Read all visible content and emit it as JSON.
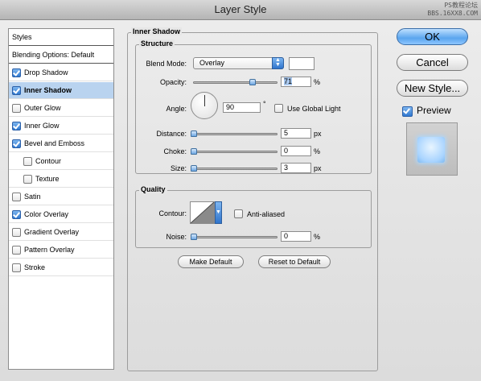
{
  "window": {
    "title": "Layer Style",
    "watermark_line1": "PS教程论坛",
    "watermark_line2": "BBS.16XX8.COM"
  },
  "styles_list": {
    "header": "Styles",
    "items": [
      {
        "label": "Blending Options: Default",
        "checkbox": false,
        "checked": false,
        "selected": false,
        "indent": 0
      },
      {
        "label": "Drop Shadow",
        "checkbox": true,
        "checked": true,
        "selected": false,
        "indent": 0
      },
      {
        "label": "Inner Shadow",
        "checkbox": true,
        "checked": true,
        "selected": true,
        "indent": 0
      },
      {
        "label": "Outer Glow",
        "checkbox": true,
        "checked": false,
        "selected": false,
        "indent": 0
      },
      {
        "label": "Inner Glow",
        "checkbox": true,
        "checked": true,
        "selected": false,
        "indent": 0
      },
      {
        "label": "Bevel and Emboss",
        "checkbox": true,
        "checked": true,
        "selected": false,
        "indent": 0
      },
      {
        "label": "Contour",
        "checkbox": true,
        "checked": false,
        "selected": false,
        "indent": 1
      },
      {
        "label": "Texture",
        "checkbox": true,
        "checked": false,
        "selected": false,
        "indent": 1
      },
      {
        "label": "Satin",
        "checkbox": true,
        "checked": false,
        "selected": false,
        "indent": 0
      },
      {
        "label": "Color Overlay",
        "checkbox": true,
        "checked": true,
        "selected": false,
        "indent": 0
      },
      {
        "label": "Gradient Overlay",
        "checkbox": true,
        "checked": false,
        "selected": false,
        "indent": 0
      },
      {
        "label": "Pattern Overlay",
        "checkbox": true,
        "checked": false,
        "selected": false,
        "indent": 0
      },
      {
        "label": "Stroke",
        "checkbox": true,
        "checked": false,
        "selected": false,
        "indent": 0
      }
    ]
  },
  "panel": {
    "title": "Inner Shadow",
    "structure": {
      "title": "Structure",
      "blend_mode_label": "Blend Mode:",
      "blend_mode_value": "Overlay",
      "shadow_color": "#ffffff",
      "opacity_label": "Opacity:",
      "opacity_value": "71",
      "opacity_unit": "%",
      "opacity_slider": 0.71,
      "angle_label": "Angle:",
      "angle_value": "90",
      "angle_unit": "°",
      "use_global_light_label": "Use Global Light",
      "use_global_light": false,
      "distance_label": "Distance:",
      "distance_value": "5",
      "distance_unit": "px",
      "distance_slider": 0.0,
      "choke_label": "Choke:",
      "choke_value": "0",
      "choke_unit": "%",
      "choke_slider": 0.0,
      "size_label": "Size:",
      "size_value": "3",
      "size_unit": "px",
      "size_slider": 0.0
    },
    "quality": {
      "title": "Quality",
      "contour_label": "Contour:",
      "anti_aliased_label": "Anti-aliased",
      "anti_aliased": false,
      "noise_label": "Noise:",
      "noise_value": "0",
      "noise_unit": "%",
      "noise_slider": 0.0
    },
    "make_default_label": "Make Default",
    "reset_default_label": "Reset to Default"
  },
  "actions": {
    "ok_label": "OK",
    "cancel_label": "Cancel",
    "new_style_label": "New Style...",
    "preview_label": "Preview",
    "preview_checked": true
  },
  "colors": {
    "accent": "#4a90e2",
    "selection": "#b9d3ef"
  }
}
